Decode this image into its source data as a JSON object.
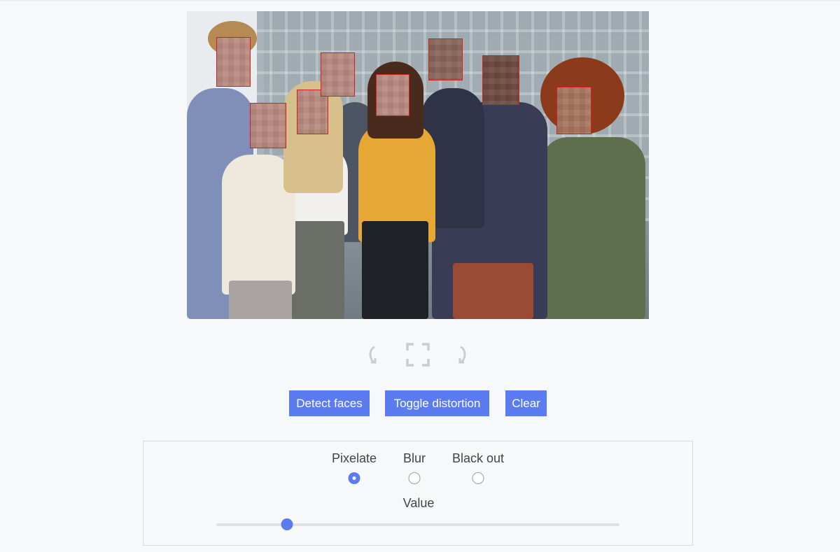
{
  "image_controls": {
    "rotate_left_icon": "rotate-left-icon",
    "fullscreen_icon": "fullscreen-icon",
    "rotate_right_icon": "rotate-right-icon"
  },
  "actions": {
    "detect_faces": "Detect faces",
    "toggle_distortion": "Toggle distortion",
    "clear": "Clear"
  },
  "distortion": {
    "options": [
      {
        "label": "Pixelate",
        "checked": true
      },
      {
        "label": "Blur",
        "checked": false
      },
      {
        "label": "Black out",
        "checked": false
      }
    ],
    "value_label": "Value",
    "value_fraction": 0.175
  },
  "colors": {
    "accent": "#5b7bf0",
    "face_box": "#d21f1f",
    "background": "#f7f8fa"
  }
}
